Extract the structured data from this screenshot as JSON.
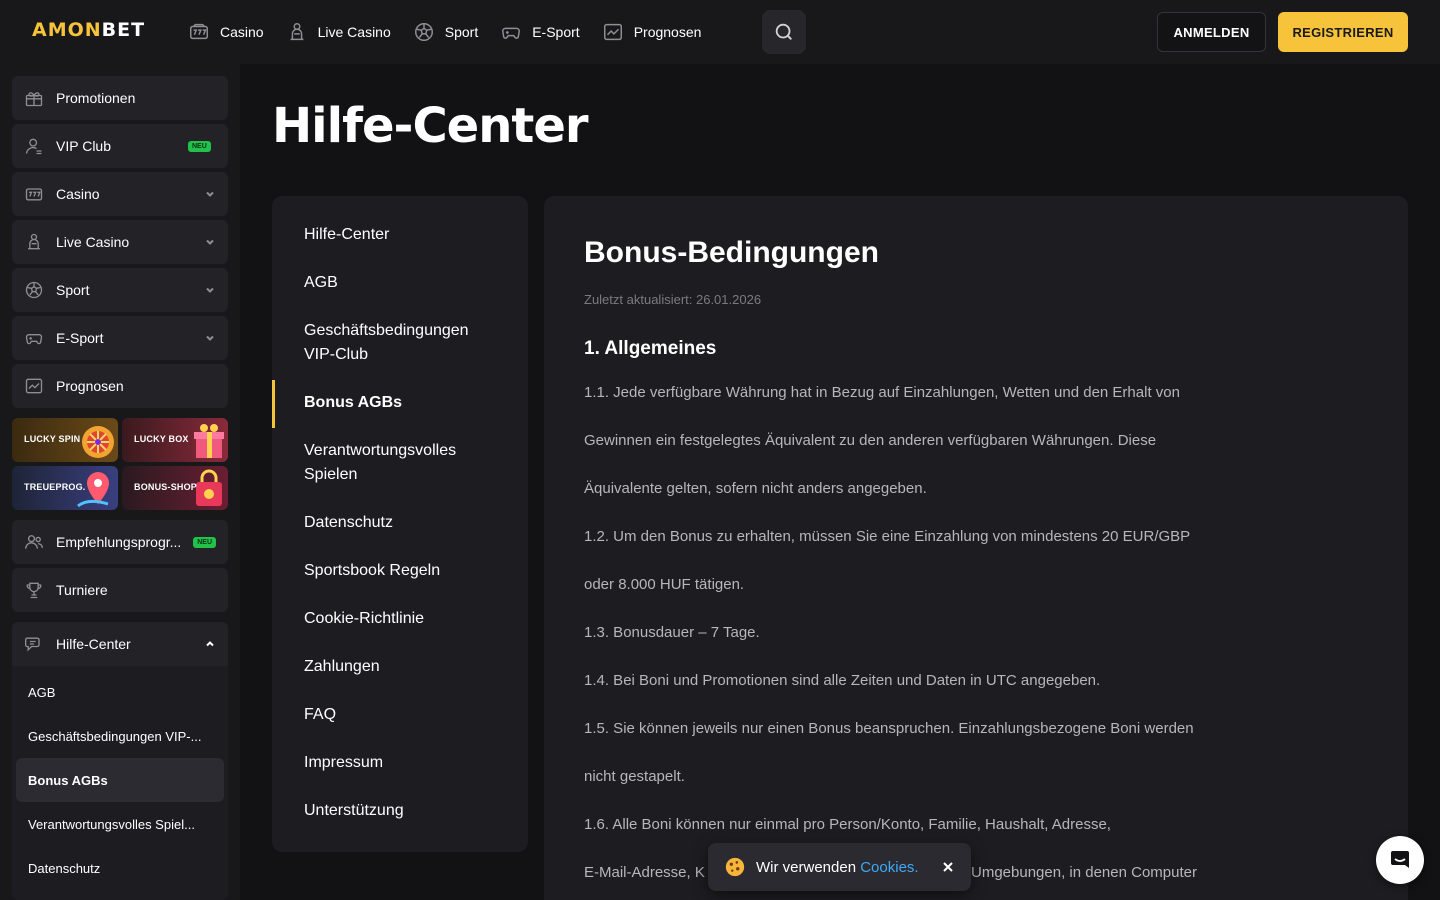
{
  "header": {
    "logo_part1": "AMON",
    "logo_part2": "BET",
    "nav": [
      {
        "label": "Casino",
        "icon": "slot-machine-icon"
      },
      {
        "label": "Live Casino",
        "icon": "dealer-icon"
      },
      {
        "label": "Sport",
        "icon": "soccer-ball-icon"
      },
      {
        "label": "E-Sport",
        "icon": "gamepad-icon"
      },
      {
        "label": "Prognosen",
        "icon": "chart-icon"
      }
    ],
    "login_label": "ANMELDEN",
    "register_label": "REGISTRIEREN"
  },
  "sidebar": {
    "items": [
      {
        "label": "Promotionen",
        "icon": "gift-icon"
      },
      {
        "label": "VIP Club",
        "icon": "vip-user-icon",
        "badge": "NEU"
      },
      {
        "label": "Casino",
        "icon": "slot-machine-icon"
      },
      {
        "label": "Live Casino",
        "icon": "dealer-icon"
      },
      {
        "label": "Sport",
        "icon": "soccer-ball-icon"
      },
      {
        "label": "E-Sport",
        "icon": "gamepad-icon"
      },
      {
        "label": "Prognosen",
        "icon": "chart-icon"
      }
    ],
    "promos": [
      {
        "label": "LUCKY SPIN"
      },
      {
        "label": "LUCKY BOX"
      },
      {
        "label": "TREUEPROG."
      },
      {
        "label": "BONUS-SHOP"
      }
    ],
    "referral": {
      "label": "Empfehlungsprogr...",
      "badge": "NEU"
    },
    "tournaments": {
      "label": "Turniere"
    },
    "help": {
      "label": "Hilfe-Center",
      "subitems": [
        {
          "label": "AGB"
        },
        {
          "label": "Geschäftsbedingungen VIP-..."
        },
        {
          "label": "Bonus AGBs"
        },
        {
          "label": "Verantwortungsvolles Spiel..."
        },
        {
          "label": "Datenschutz"
        }
      ]
    }
  },
  "main": {
    "page_title": "Hilfe-Center",
    "help_nav": [
      {
        "line1": "Hilfe-Center"
      },
      {
        "line1": "AGB"
      },
      {
        "line1": "Geschäftsbedingungen",
        "line2": "VIP-Club"
      },
      {
        "line1": "Bonus AGBs"
      },
      {
        "line1": "Verantwortungsvolles",
        "line2": "Spielen"
      },
      {
        "line1": "Datenschutz"
      },
      {
        "line1": "Sportsbook Regeln"
      },
      {
        "line1": "Cookie-Richtlinie"
      },
      {
        "line1": "Zahlungen"
      },
      {
        "line1": "FAQ"
      },
      {
        "line1": "Impressum"
      },
      {
        "line1": "Unterstützung"
      }
    ],
    "content": {
      "title": "Bonus-Bedingungen",
      "updated": "Zuletzt aktualisiert: 26.01.2026",
      "section_title": "1. Allgemeines",
      "lines": [
        "1.1. Jede verfügbare Währung hat in Bezug auf Einzahlungen, Wetten und den Erhalt von",
        "Gewinnen ein festgelegtes Äquivalent zu den anderen verfügbaren Währungen. Diese",
        "Äquivalente gelten, sofern nicht anders angegeben.",
        "1.2. Um den Bonus zu erhalten, müssen Sie eine Einzahlung von mindestens 20 EUR/GBP",
        "oder 8.000 HUF tätigen.",
        "1.3. Bonusdauer – 7 Tage.",
        "1.4. Bei Boni und Promotionen sind alle Zeiten und Daten in UTC angegeben.",
        "1.5. Sie können jeweils nur einen Bonus beanspruchen. Einzahlungsbezogene Boni werden",
        "nicht gestapelt.",
        "1.6. Alle Boni können nur einmal pro Person/Konto, Familie, Haushalt, Adresse,",
        "E-Mail-Adresse, K",
        "Umgebungen, in denen Computer"
      ]
    }
  },
  "cookie_banner": {
    "text": "Wir verwenden",
    "link": "Cookies."
  },
  "colors": {
    "accent": "#f7c33a",
    "badge": "#20c24a",
    "link": "#3fa9f5"
  }
}
